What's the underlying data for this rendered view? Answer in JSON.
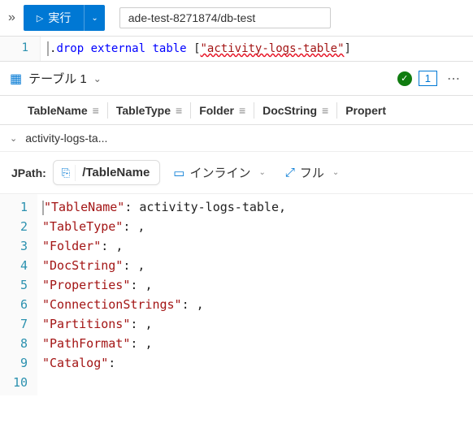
{
  "toolbar": {
    "run_label": "実行",
    "scope": "ade-test-8271874/db-test"
  },
  "editor": {
    "line_no": "1",
    "code_prefix": ".",
    "kw1": "drop",
    "kw2": "external",
    "kw3": "table",
    "br_open": "[",
    "str_content": "\"activity-logs-table\"",
    "br_close": "]"
  },
  "results": {
    "title": "テーブル 1",
    "count": "1"
  },
  "columns": [
    "TableName",
    "TableType",
    "Folder",
    "DocString",
    "Propert"
  ],
  "row0": "activity-logs-ta...",
  "jpath": {
    "label": "JPath:",
    "path": "/TableName",
    "inline": "インライン",
    "full": "フル"
  },
  "json": {
    "lines": [
      "1",
      "2",
      "3",
      "4",
      "5",
      "6",
      "7",
      "8",
      "9",
      "10"
    ],
    "rows": [
      {
        "key": "\"TableName\"",
        "val": "activity-logs-table",
        "comma": true
      },
      {
        "key": "\"TableType\"",
        "val": "",
        "comma": true
      },
      {
        "key": "\"Folder\"",
        "val": "",
        "comma": true
      },
      {
        "key": "\"DocString\"",
        "val": "",
        "comma": true
      },
      {
        "key": "\"Properties\"",
        "val": "",
        "comma": true
      },
      {
        "key": "\"ConnectionStrings\"",
        "val": "",
        "comma": true
      },
      {
        "key": "\"Partitions\"",
        "val": "",
        "comma": true
      },
      {
        "key": "\"PathFormat\"",
        "val": "",
        "comma": true
      },
      {
        "key": "\"Catalog\"",
        "val": "",
        "comma": false
      }
    ]
  }
}
